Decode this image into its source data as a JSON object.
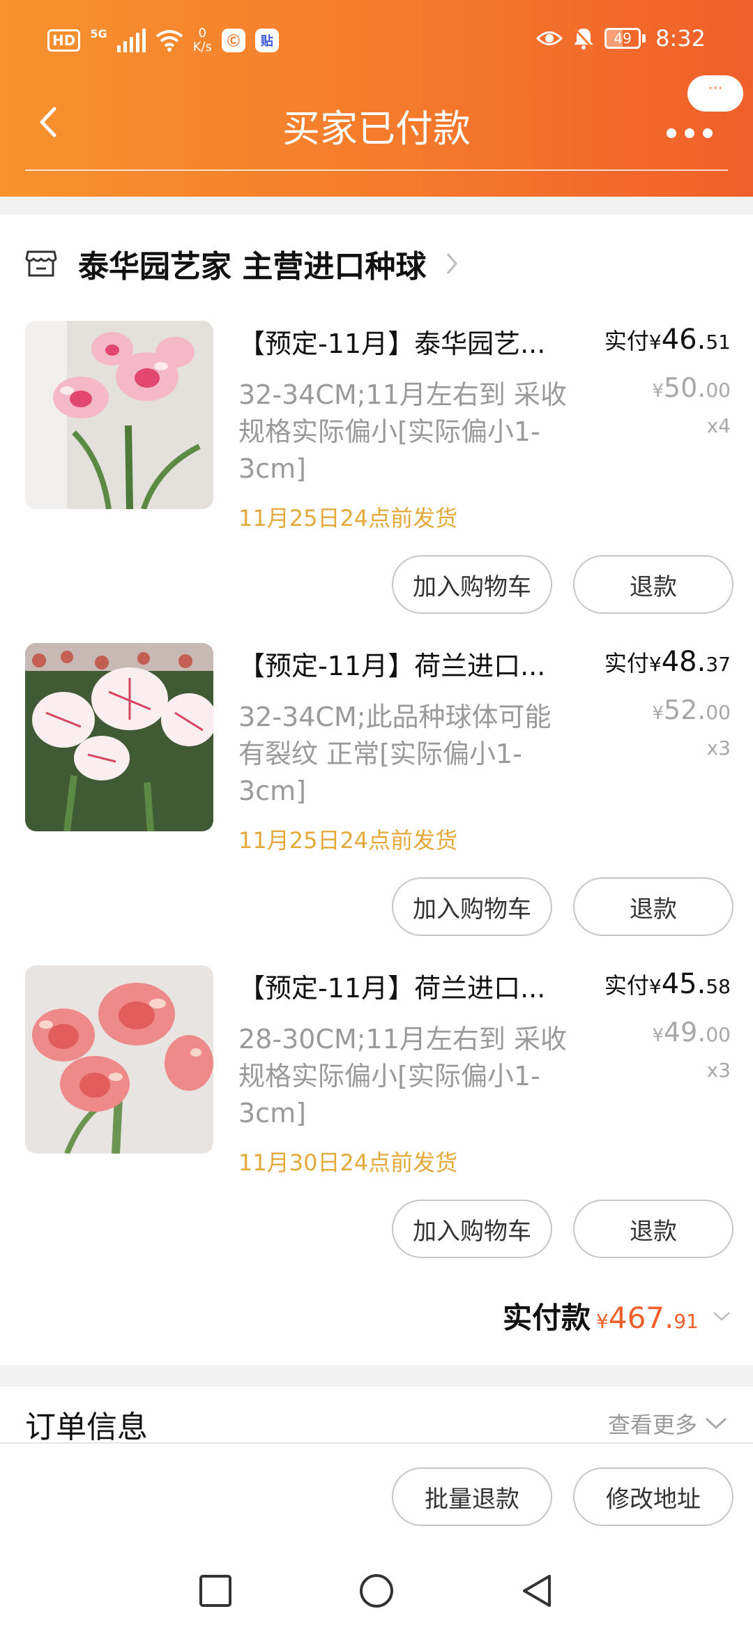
{
  "status_bar": {
    "hd": "HD",
    "network": "5G",
    "speed_value": "0",
    "speed_unit": "K/s",
    "app_icon_1": "Ⓒ",
    "app_icon_2": "贴",
    "battery": "49",
    "time": "8:32"
  },
  "header": {
    "title": "买家已付款",
    "bubble_text": "···"
  },
  "shop": {
    "name": "泰华园艺家  主营进口种球"
  },
  "items": [
    {
      "title": "【预定-11月】泰华园艺...",
      "spec": "32-34CM;11月左右到 采收规格实际偏小[实际偏小1-3cm]",
      "ship": "11月25日24点前发货",
      "paid_label": "实付",
      "paid_yen": "¥",
      "paid_int": "46.",
      "paid_dec": "51",
      "orig_yen": "¥",
      "orig_int": "50.",
      "orig_dec": "00",
      "qty": "x4",
      "cart_label": "加入购物车",
      "refund_label": "退款"
    },
    {
      "title": "【预定-11月】荷兰进口...",
      "spec": "32-34CM;此品种球体可能有裂纹 正常[实际偏小1-3cm]",
      "ship": "11月25日24点前发货",
      "paid_label": "实付",
      "paid_yen": "¥",
      "paid_int": "48.",
      "paid_dec": "37",
      "orig_yen": "¥",
      "orig_int": "52.",
      "orig_dec": "00",
      "qty": "x3",
      "cart_label": "加入购物车",
      "refund_label": "退款"
    },
    {
      "title": "【预定-11月】荷兰进口...",
      "spec": "28-30CM;11月左右到 采收规格实际偏小[实际偏小1-3cm]",
      "ship": "11月30日24点前发货",
      "paid_label": "实付",
      "paid_yen": "¥",
      "paid_int": "45.",
      "paid_dec": "58",
      "orig_yen": "¥",
      "orig_int": "49.",
      "orig_dec": "00",
      "qty": "x3",
      "cart_label": "加入购物车",
      "refund_label": "退款"
    }
  ],
  "total": {
    "label": "实付款",
    "yen": "¥",
    "int": "467.",
    "dec": "91"
  },
  "order_info": {
    "title": "订单信息",
    "more": "查看更多"
  },
  "actions": {
    "batch_refund": "批量退款",
    "change_address": "修改地址"
  },
  "colors": {
    "brand_orange": "#f47a2c",
    "price_orange": "#f05f2a",
    "ship_gold": "#e3a93b"
  }
}
